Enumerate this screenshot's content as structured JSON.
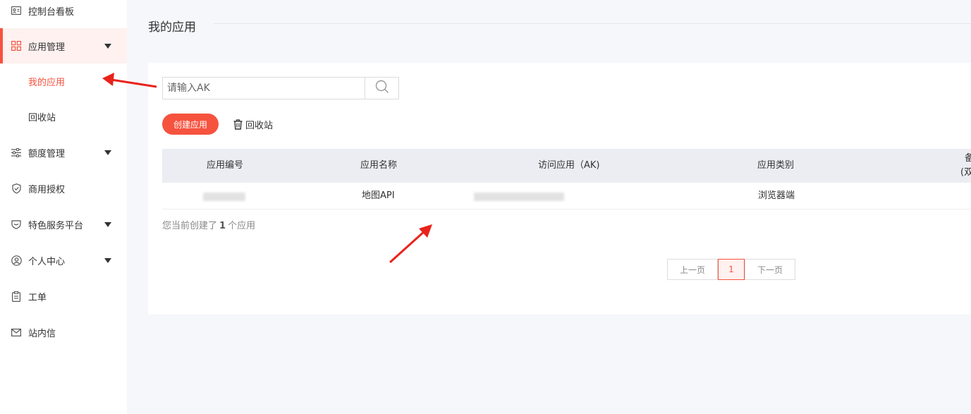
{
  "sidebar": {
    "items": [
      {
        "label": "控制台看板",
        "icon": "id-card-icon"
      },
      {
        "label": "应用管理",
        "icon": "grid-icon",
        "expanded": true
      },
      {
        "label": "我的应用"
      },
      {
        "label": "回收站"
      },
      {
        "label": "额度管理",
        "icon": "sliders-icon"
      },
      {
        "label": "商用授权",
        "icon": "shield-check-icon"
      },
      {
        "label": "特色服务平台",
        "icon": "badge-icon"
      },
      {
        "label": "个人中心",
        "icon": "user-circle-icon"
      },
      {
        "label": "工单",
        "icon": "clipboard-icon"
      },
      {
        "label": "站内信",
        "icon": "mail-icon"
      }
    ]
  },
  "main": {
    "title": "我的应用",
    "search": {
      "placeholder": "请输入AK",
      "value": ""
    },
    "create_label": "创建应用",
    "recycle_label": "回收站",
    "table": {
      "headers": [
        "应用编号",
        "应用名称",
        "访问应用（AK)",
        "应用类别",
        "备",
        "(双"
      ],
      "rows": [
        {
          "id": "",
          "name": "地图API",
          "ak": "",
          "category": "浏览器端"
        }
      ]
    },
    "summary": {
      "prefix": "您当前创建了",
      "count": "1",
      "suffix": "个应用"
    },
    "pagination": {
      "prev": "上一页",
      "current": "1",
      "next": "下一页"
    }
  },
  "colors": {
    "accent": "#f6533f",
    "active_bg": "#fef1ef",
    "table_header_bg": "#ebedf3",
    "page_bg": "#f6f7fb"
  }
}
